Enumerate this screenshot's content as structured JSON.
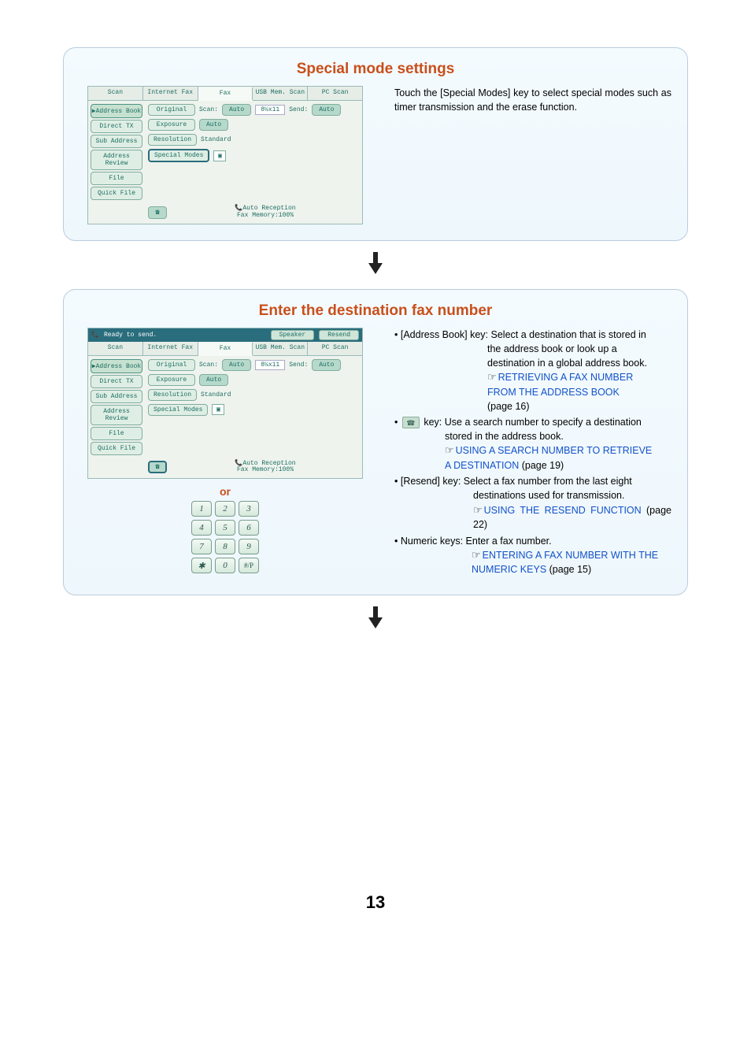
{
  "section1": {
    "title": "Special mode settings",
    "description": "Touch the [Special Modes] key to select special modes such as timer transmission and the erase function."
  },
  "section2": {
    "title": "Enter the destination fax number",
    "status": "Ready to send.",
    "speaker": "Speaker",
    "resend": "Resend",
    "or": "or",
    "items": {
      "addr_key": "[Address Book] key:",
      "addr_desc1": "Select a destination that is stored in",
      "addr_desc2": "the address book or look up a",
      "addr_desc3": "destination in a global address book.",
      "addr_link1": "RETRIEVING A FAX NUMBER",
      "addr_link2": "FROM THE ADDRESS BOOK",
      "addr_page": "(page 16)",
      "search_key": " key:",
      "search_desc1": "Use a search number to specify a destination",
      "search_desc2": "stored in the address book.",
      "search_link1": "USING A SEARCH NUMBER TO RETRIEVE",
      "search_link2": "A DESTINATION",
      "search_page": " (page 19)",
      "resend_key": "[Resend] key:",
      "resend_desc1": "Select a fax number from the last eight",
      "resend_desc2": "destinations used for transmission.",
      "resend_link": "USING THE RESEND FUNCTION",
      "resend_page": " (page 22)",
      "numeric_key": "Numeric keys:",
      "numeric_desc": "Enter a fax number.",
      "numeric_link1": "ENTERING A FAX NUMBER WITH THE",
      "numeric_link2": "NUMERIC KEYS",
      "numeric_page": " (page 15)"
    }
  },
  "screen": {
    "tabs": {
      "scan": "Scan",
      "ifax": "Internet Fax",
      "fax": "Fax",
      "usb": "USB Mem. Scan",
      "pc": "PC Scan"
    },
    "side": {
      "addr": "Address Book",
      "direct": "Direct TX",
      "sub": "Sub Address",
      "review": "Address Review",
      "file": "File",
      "qfile": "Quick File"
    },
    "rows": {
      "original": "Original",
      "scan": "Scan:",
      "auto": "Auto",
      "size": "8½x11",
      "send": "Send:",
      "exposure": "Exposure",
      "resolution": "Resolution",
      "standard": "Standard",
      "special": "Special Modes"
    },
    "footer1": "Auto Reception",
    "footer2": "Fax Memory:100%"
  },
  "keypad": [
    "1",
    "2",
    "3",
    "4",
    "5",
    "6",
    "7",
    "8",
    "9",
    "✱",
    "0",
    "#/P"
  ],
  "page_number": "13"
}
